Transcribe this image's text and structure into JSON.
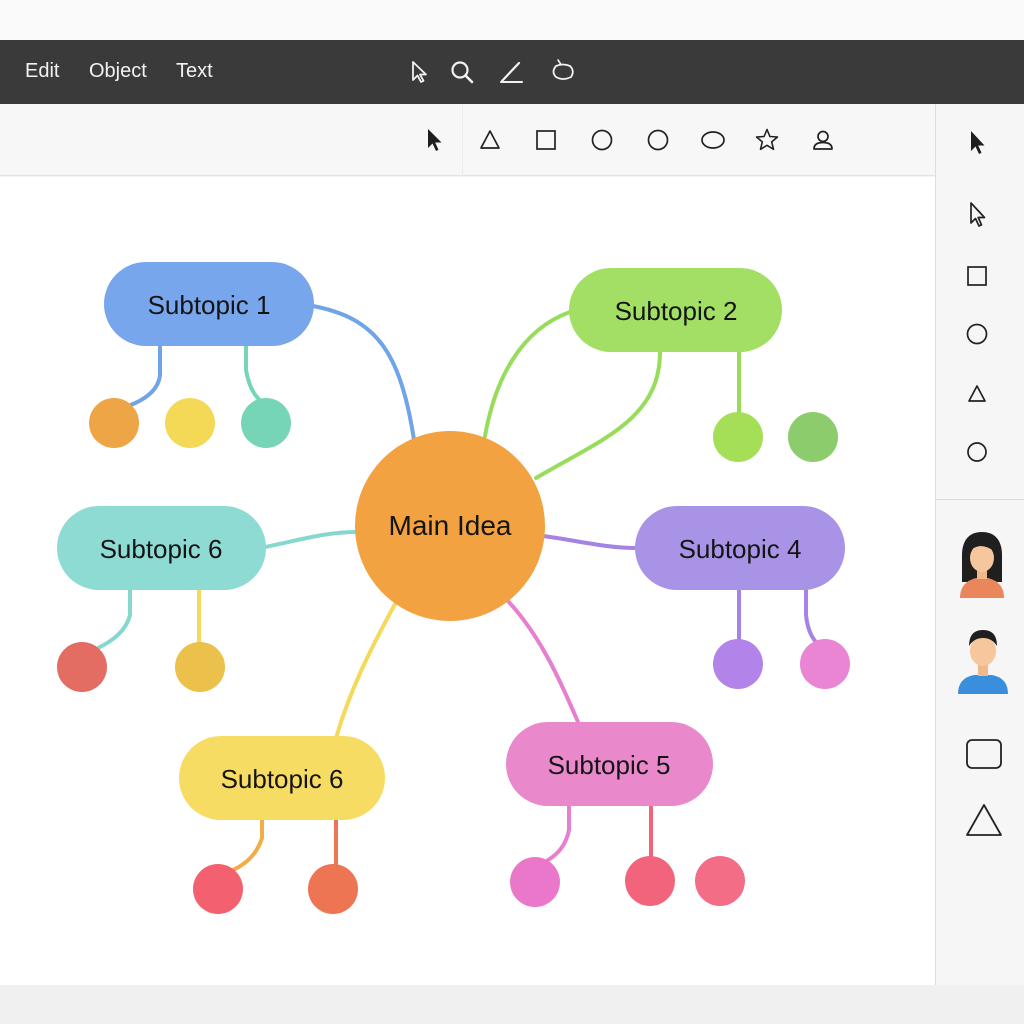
{
  "menubar": {
    "items": [
      "Edit",
      "Object",
      "Text"
    ],
    "tools": [
      "pointer-icon",
      "zoom-icon",
      "pen-icon",
      "lasso-icon"
    ]
  },
  "toolbar": {
    "tools": [
      "select-arrow-icon",
      "triangle-icon",
      "square-icon",
      "circle-icon",
      "circle-icon",
      "ellipse-icon",
      "star-icon",
      "person-icon"
    ]
  },
  "sidebar": {
    "tools": [
      "select-arrow-icon",
      "pointer-icon",
      "square-icon",
      "circle-icon",
      "triangle-icon",
      "circle-icon"
    ],
    "assets": [
      "woman-avatar-icon",
      "man-avatar-icon",
      "rounded-rect-icon",
      "triangle-icon"
    ]
  },
  "mindmap": {
    "center": {
      "label": "Main Idea",
      "color": "#f2a241"
    },
    "subtopics": [
      {
        "label": "Subtopic 1",
        "color": "#78a6ec",
        "line": "#6fa4e8",
        "dots": [
          "#eea545",
          "#f4d957",
          "#77d5b7"
        ]
      },
      {
        "label": "Subtopic 2",
        "color": "#a2df64",
        "line": "#98dc5c",
        "dots": [
          "#a4df57",
          "#8ccc6c"
        ]
      },
      {
        "label": "Subtopic 4",
        "color": "#a893e6",
        "line": "#a682e4",
        "dots": [
          "#b283e8",
          "#e985d3"
        ]
      },
      {
        "label": "Subtopic 5",
        "color": "#ea88cc",
        "line": "#e67fd0",
        "dots": [
          "#ea77c9",
          "#f2647c",
          "#f36d87"
        ]
      },
      {
        "label": "Subtopic 6",
        "color": "#f7dc63",
        "line": "#f5d95a",
        "dots": [
          "#f3606f",
          "#ee7553"
        ]
      },
      {
        "label": "Subtopic 6",
        "color": "#8ddbd3",
        "line": "#86d8cf",
        "dots": [
          "#e36d63",
          "#ebc04b"
        ]
      }
    ]
  },
  "colors": {
    "menubar_bg": "#3a3a3a",
    "canvas_bg": "#ffffff",
    "panel_bg": "#f6f6f6"
  }
}
